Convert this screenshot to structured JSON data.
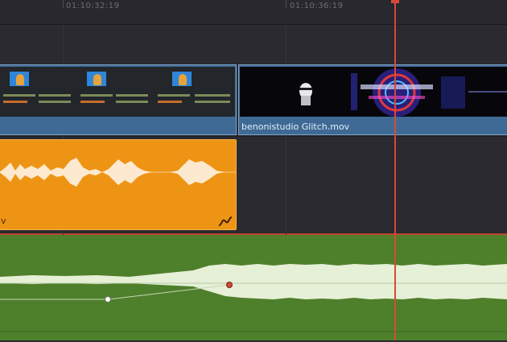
{
  "ruler": {
    "timecodes": [
      "01:10:32:19",
      "01:10:36:19"
    ]
  },
  "tracks": {
    "video": {
      "clips": [
        {
          "label": ""
        },
        {
          "label": "benonistudio Glitch.mov"
        }
      ]
    },
    "audio1": {
      "clip_label": "v"
    }
  },
  "colors": {
    "video_clip": "#3f6a96",
    "audio_clip": "#ee9414",
    "audio_track_green": "#4e7f2b",
    "playhead": "#d44a37"
  },
  "icons": [
    "curve-icon",
    "keyframe-icon",
    "playhead-icon"
  ]
}
